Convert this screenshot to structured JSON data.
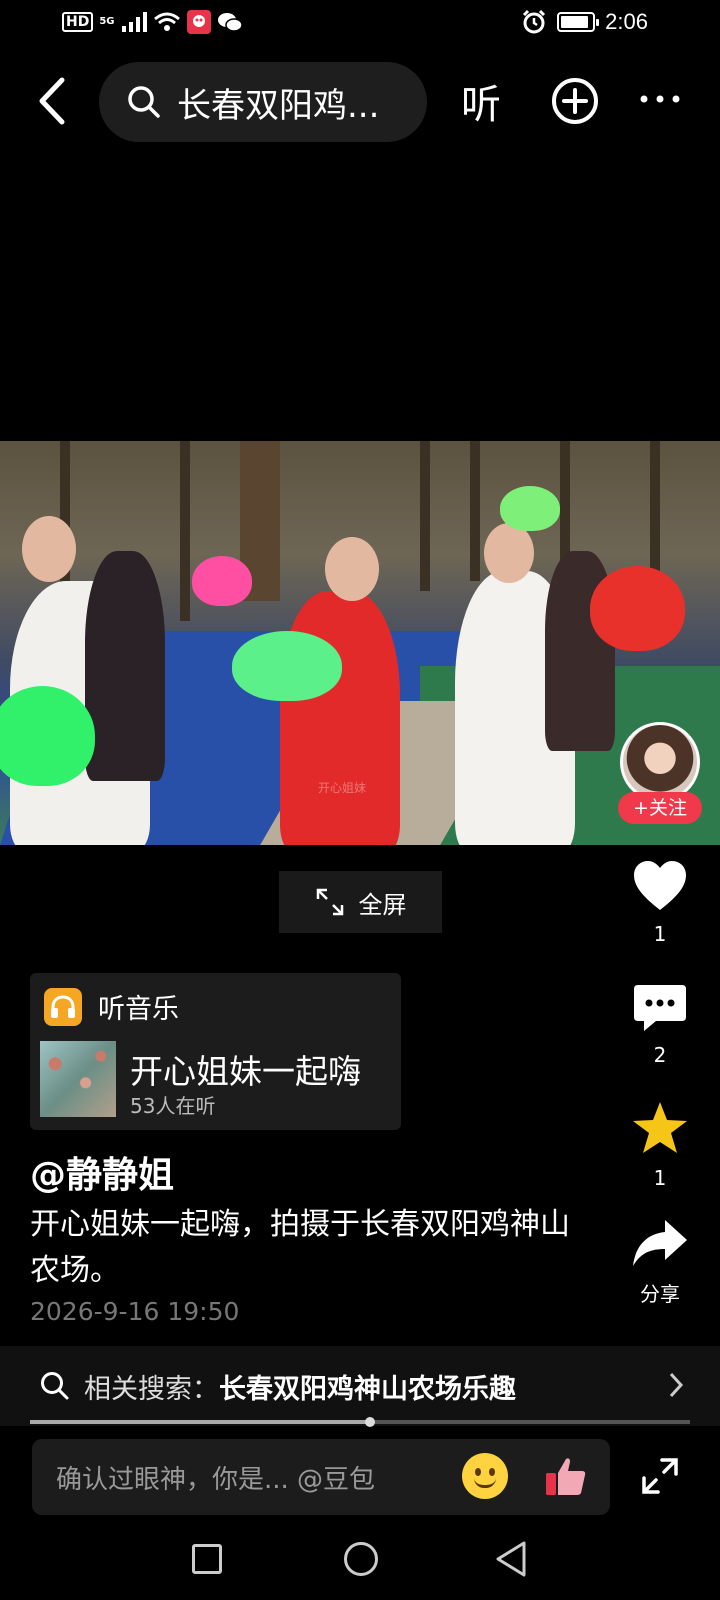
{
  "status_bar": {
    "hd": "HD",
    "network": "5G",
    "time": "2:06",
    "battery_level": 0.9
  },
  "header": {
    "search_query": "长春双阳鸡...",
    "listen_label": "听",
    "icons": [
      "back-icon",
      "search-icon",
      "add-circle-icon",
      "more-icon"
    ]
  },
  "video": {
    "follow_label": "+关注",
    "watermark": "开心姐妹"
  },
  "fullscreen_label": "全屏",
  "actions": {
    "likes": "1",
    "comments": "2",
    "favorites": "1",
    "share_label": "分享",
    "colors": {
      "favorite": "#f5c518"
    }
  },
  "music": {
    "header_label": "听音乐",
    "song_title": "开心姐妹一起嗨",
    "listeners": "53人在听"
  },
  "post": {
    "author": "@静静姐",
    "description": "开心姐妹一起嗨，拍摄于长春双阳鸡神山农场。",
    "timestamp": "2026-9-16 19:50"
  },
  "related": {
    "label": "相关搜索：",
    "term": "长春双阳鸡神山农场乐趣",
    "progress": 0.515
  },
  "comment": {
    "placeholder": "确认过眼神，你是...  @豆包"
  }
}
